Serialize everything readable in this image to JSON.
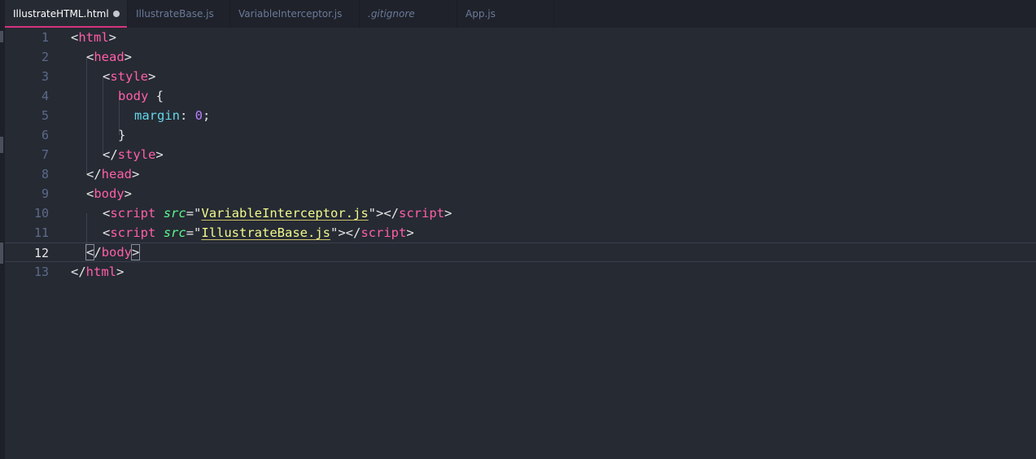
{
  "tabs": [
    {
      "label": "IllustrateHTML.html",
      "active": true,
      "dirty": true,
      "italic": false
    },
    {
      "label": "IllustrateBase.js",
      "active": false,
      "dirty": false,
      "italic": false
    },
    {
      "label": "VariableInterceptor.js",
      "active": false,
      "dirty": false,
      "italic": false
    },
    {
      "label": ".gitignore",
      "active": false,
      "dirty": false,
      "italic": true
    },
    {
      "label": "App.js",
      "active": false,
      "dirty": false,
      "italic": false
    }
  ],
  "editor": {
    "current_line": 12,
    "line_numbers": [
      "1",
      "2",
      "3",
      "4",
      "5",
      "6",
      "7",
      "8",
      "9",
      "10",
      "11",
      "12",
      "13"
    ],
    "code": {
      "l1": {
        "open": "<",
        "tag": "html",
        "close": ">"
      },
      "l2": {
        "open": "<",
        "tag": "head",
        "close": ">"
      },
      "l3": {
        "open": "<",
        "tag": "style",
        "close": ">"
      },
      "l4": {
        "selector": "body",
        "brace": " {"
      },
      "l5": {
        "prop": "margin",
        "colon": ": ",
        "value": "0",
        "semi": ";"
      },
      "l6": {
        "brace": "}"
      },
      "l7": {
        "open": "</",
        "tag": "style",
        "close": ">"
      },
      "l8": {
        "open": "</",
        "tag": "head",
        "close": ">"
      },
      "l9": {
        "open": "<",
        "tag": "body",
        "close": ">"
      },
      "l10": {
        "open": "<",
        "tag": "script",
        "attr": "src",
        "eq": "=\"",
        "value": "VariableInterceptor.js",
        "mid": "\"></",
        "end_tag": "script",
        "close": ">"
      },
      "l11": {
        "open": "<",
        "tag": "script",
        "attr": "src",
        "eq": "=\"",
        "value": "IllustrateBase.js",
        "mid": "\"></",
        "end_tag": "script",
        "close": ">"
      },
      "l12": {
        "lt": "<",
        "slash": "/",
        "tag": "body",
        "close": ">"
      },
      "l13": {
        "open": "</",
        "tag": "html",
        "close": ">"
      }
    }
  },
  "colors": {
    "background": "#262a33",
    "tab_bar": "#1f222a",
    "active_tab_underline": "#d6337f",
    "tag": "#ff5fa8",
    "attribute": "#5af78e",
    "string": "#f1fa8c",
    "property": "#62d6e8",
    "number": "#b980ff"
  }
}
